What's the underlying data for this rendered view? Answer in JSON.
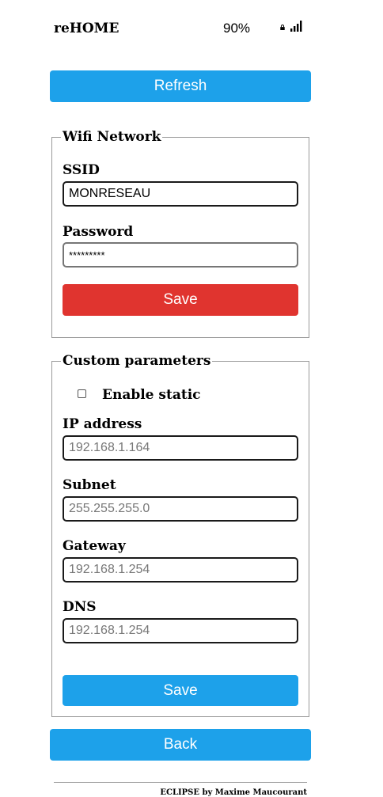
{
  "status_bar": {
    "app_name": "reHOME",
    "battery": "90%",
    "lock_icon": "lock-icon",
    "signal_icon": "signal-bars-icon"
  },
  "refresh_label": "Refresh",
  "wifi": {
    "legend": "Wifi Network",
    "ssid_label": "SSID",
    "ssid_value": "MONRESEAU",
    "password_label": "Password",
    "password_value": "*********",
    "save_label": "Save",
    "save_color": "#e0342f"
  },
  "custom": {
    "legend": "Custom parameters",
    "enable_static_label": "Enable static",
    "enable_static_checked": false,
    "ip_label": "IP address",
    "ip_placeholder": "192.168.1.164",
    "subnet_label": "Subnet",
    "subnet_placeholder": "255.255.255.0",
    "gateway_label": "Gateway",
    "gateway_placeholder": "192.168.1.254",
    "dns_label": "DNS",
    "dns_placeholder": "192.168.1.254",
    "save_label": "Save"
  },
  "back_label": "Back",
  "footer": "ECLIPSE by Maxime Maucourant",
  "accent_color": "#1da1ea"
}
